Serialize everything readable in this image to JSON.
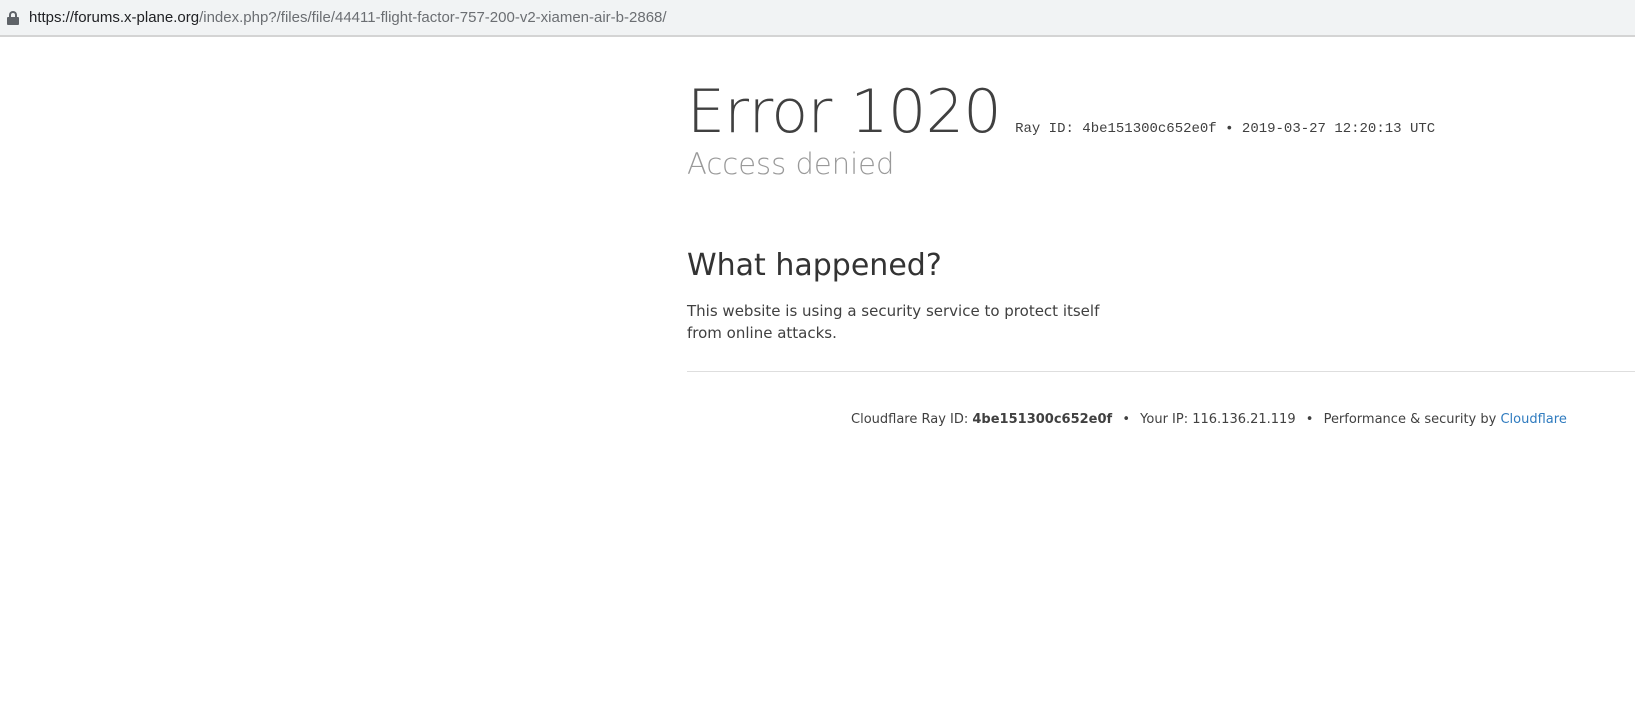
{
  "browser": {
    "url_host": "https://forums.x-plane.org",
    "url_path": "/index.php?/files/file/44411-flight-factor-757-200-v2-xiamen-air-b-2868/",
    "secure_icon": "lock-icon"
  },
  "error": {
    "title": "Error 1020",
    "ray_line": "Ray ID: 4be151300c652e0f • 2019-03-27 12:20:13 UTC",
    "subtitle": "Access denied"
  },
  "what_happened": {
    "heading": "What happened?",
    "text": "This website is using a security service to protect itself from online attacks."
  },
  "footer": {
    "ray_label": "Cloudflare Ray ID:",
    "ray_id": "4be151300c652e0f",
    "bullet": "•",
    "ip_text": "Your IP: 116.136.21.119",
    "perf_text": "Performance & security by",
    "link_text": "Cloudflare",
    "link_color": "#2f7bbf"
  }
}
